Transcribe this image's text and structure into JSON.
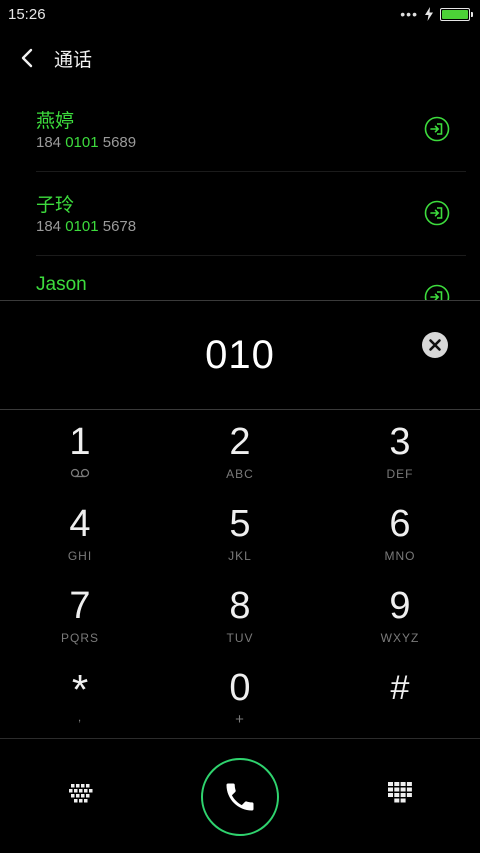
{
  "status": {
    "time": "15:26",
    "dots": "•••",
    "battery_level": 1.0
  },
  "header": {
    "title": "通话"
  },
  "results": [
    {
      "name": "燕婷",
      "number_pre": "184 ",
      "number_hl": "0101",
      "number_post": " 5689"
    },
    {
      "name": "子玲",
      "number_pre": "184 ",
      "number_hl": "0101",
      "number_post": " 5678"
    },
    {
      "name": "Jason",
      "number_pre": "",
      "number_hl": "",
      "number_post": ""
    }
  ],
  "display": {
    "digits": "010"
  },
  "keypad": [
    {
      "main": "1",
      "sub": ""
    },
    {
      "main": "2",
      "sub": "ABC"
    },
    {
      "main": "3",
      "sub": "DEF"
    },
    {
      "main": "4",
      "sub": "GHI"
    },
    {
      "main": "5",
      "sub": "JKL"
    },
    {
      "main": "6",
      "sub": "MNO"
    },
    {
      "main": "7",
      "sub": "PQRS"
    },
    {
      "main": "8",
      "sub": "TUV"
    },
    {
      "main": "9",
      "sub": "WXYZ"
    },
    {
      "main": "*",
      "sub": ","
    },
    {
      "main": "0",
      "sub": "+"
    },
    {
      "main": "#",
      "sub": ""
    }
  ],
  "colors": {
    "accent": "#3ddc3d",
    "call": "#2fd36e",
    "background": "#000000"
  },
  "icons": {
    "back": "chevron-left-icon",
    "enter": "login-arrow-icon",
    "clear": "close-circle-icon",
    "voicemail": "voicemail-icon",
    "call": "phone-icon",
    "dialpad_left": "dialpad-dots-icon",
    "dialpad_right": "dialpad-grid-icon"
  }
}
